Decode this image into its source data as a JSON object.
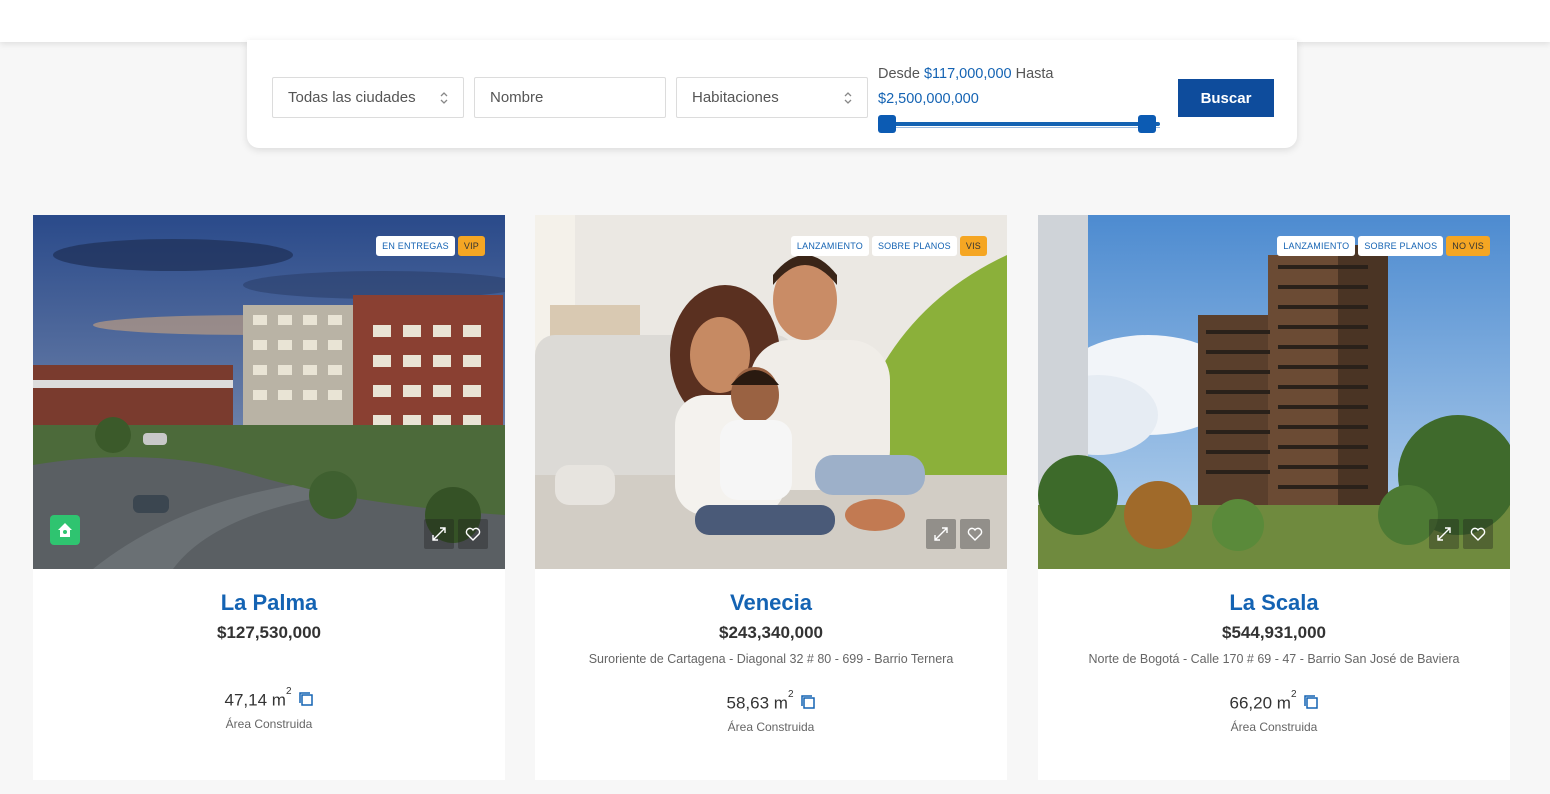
{
  "search": {
    "city_select": "Todas las ciudades",
    "name_placeholder": "Nombre",
    "rooms_select": "Habitaciones",
    "range_from_label": "Desde",
    "range_from_value": "$117,000,000",
    "range_to_label": "Hasta",
    "range_to_value": "$2,500,000,000",
    "search_button": "Buscar"
  },
  "colors": {
    "accent": "#1463b3",
    "button": "#0e4c9c",
    "badge_highlight": "#f5a623",
    "home_badge": "#2fc470"
  },
  "projects": [
    {
      "name": "La Palma",
      "price": "$127,530,000",
      "address": "",
      "area": "47,14 m",
      "area_unit_exp": "2",
      "area_label": "Área Construida",
      "badges": [
        "EN ENTREGAS",
        "VIP"
      ],
      "icons": [
        "home-icon",
        "expand-icon",
        "heart-icon",
        "area-icon"
      ]
    },
    {
      "name": "Venecia",
      "price": "$243,340,000",
      "address": "Suroriente de Cartagena - Diagonal 32 # 80 - 699 - Barrio Ternera",
      "area": "58,63 m",
      "area_unit_exp": "2",
      "area_label": "Área Construida",
      "badges": [
        "LANZAMIENTO",
        "SOBRE PLANOS",
        "VIS"
      ],
      "icons": [
        "expand-icon",
        "heart-icon",
        "area-icon"
      ]
    },
    {
      "name": "La Scala",
      "price": "$544,931,000",
      "address": "Norte de Bogotá - Calle 170 # 69 - 47 - Barrio San José de Baviera",
      "area": "66,20 m",
      "area_unit_exp": "2",
      "area_label": "Área Construida",
      "badges": [
        "LANZAMIENTO",
        "SOBRE PLANOS",
        "NO VIS"
      ],
      "icons": [
        "expand-icon",
        "heart-icon",
        "area-icon"
      ]
    }
  ]
}
